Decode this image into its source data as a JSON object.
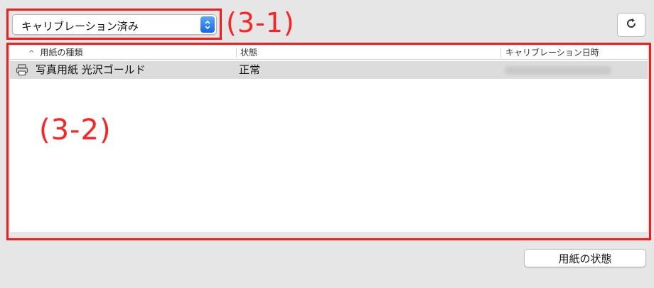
{
  "filter": {
    "selected": "キャリブレーション済み"
  },
  "callouts": {
    "top": "(3-1)",
    "table": "(3-2)"
  },
  "table": {
    "columns": [
      "用紙の種類",
      "状態",
      "キャリブレーション日時"
    ],
    "sort_column": "用紙の種類",
    "rows": [
      {
        "paper_type": "写真用紙 光沢ゴールド",
        "status": "正常",
        "datetime": ""
      }
    ]
  },
  "buttons": {
    "paper_status": "用紙の状態"
  },
  "icons": {
    "refresh": "refresh-icon",
    "printer": "printer-icon",
    "stepper": "up-down-chevron-icon"
  },
  "colors": {
    "callout": "#ff1a1a",
    "accent": "#1466e0"
  }
}
